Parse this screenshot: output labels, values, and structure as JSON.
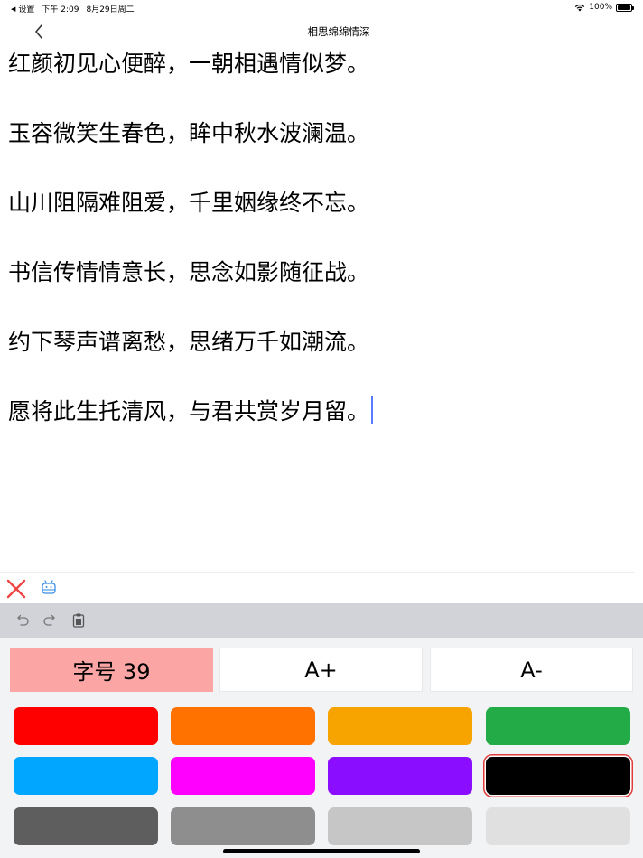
{
  "status_bar": {
    "back_app": "设置",
    "time": "下午 2:09",
    "date": "8月29日周二",
    "battery": "100%"
  },
  "nav": {
    "title": "相思绵绵情深"
  },
  "poem": {
    "lines": [
      "红颜初见心便醉，一朝相遇情似梦。",
      "玉容微笑生春色，眸中秋水波澜温。",
      "山川阻隔难阻爱，千里姻缘终不忘。",
      "书信传情情意长，思念如影随征战。",
      "约下琴声谱离愁，思绪万千如潮流。",
      "愿将此生托清风，与君共赏岁月留。"
    ]
  },
  "font_panel": {
    "size_label": "字号 39",
    "increase_label": "A+",
    "decrease_label": "A-",
    "colors": [
      {
        "name": "red",
        "hex": "#ff0000"
      },
      {
        "name": "orange",
        "hex": "#ff7200"
      },
      {
        "name": "amber",
        "hex": "#f8a400"
      },
      {
        "name": "green",
        "hex": "#22ab46"
      },
      {
        "name": "sky-blue",
        "hex": "#00a6ff"
      },
      {
        "name": "magenta",
        "hex": "#ff00ff"
      },
      {
        "name": "purple",
        "hex": "#8a0dff"
      },
      {
        "name": "black",
        "hex": "#000000",
        "selected": true
      },
      {
        "name": "dark-gray",
        "hex": "#5e5e5e"
      },
      {
        "name": "gray",
        "hex": "#8e8e8e"
      },
      {
        "name": "light-gray",
        "hex": "#c6c6c6"
      },
      {
        "name": "lighter-gray",
        "hex": "#e0e0e0"
      }
    ]
  },
  "icons": {
    "back": "chevron-left-icon",
    "close": "close-icon",
    "robot": "robot-icon",
    "undo": "undo-icon",
    "redo": "redo-icon",
    "paste": "paste-icon"
  }
}
